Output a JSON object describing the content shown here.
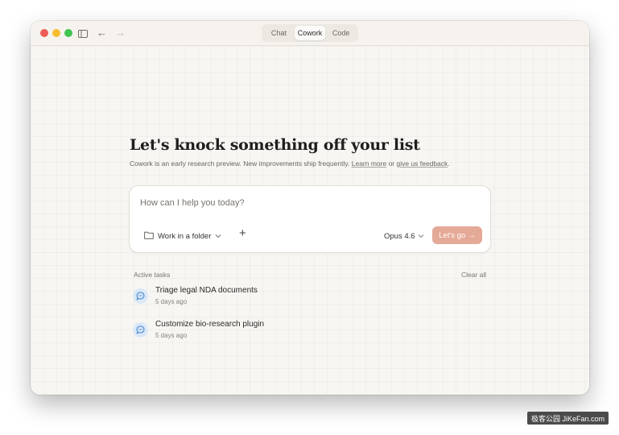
{
  "titlebar": {
    "modes": [
      "Chat",
      "Cowork",
      "Code"
    ],
    "active_mode": "Cowork"
  },
  "hero": {
    "headline": "Let's knock something off your list",
    "subtext_pre": "Cowork is an early research preview. New improvements ship frequently. ",
    "learn_more": "Learn more",
    "subtext_mid": " or ",
    "feedback": "give us feedback",
    "subtext_post": "."
  },
  "prompt": {
    "placeholder": "How can I help you today?",
    "folder_label": "Work in a folder",
    "plus": "+",
    "model": "Opus 4.6",
    "go_label": "Let's go",
    "go_arrow": "→"
  },
  "tasks": {
    "label": "Active tasks",
    "clear_label": "Clear all",
    "items": [
      {
        "title": "Triage legal NDA documents",
        "time": "5 days ago"
      },
      {
        "title": "Customize bio-research plugin",
        "time": "5 days ago"
      }
    ]
  },
  "watermark": "极客公园 JiKeFan.com",
  "colors": {
    "accent": "#e5a997",
    "window_bg": "#f8f6f3",
    "task_icon_bg": "#dbe8f7",
    "task_icon_fg": "#3d7fcb"
  },
  "icons": {
    "traffic": [
      "close-icon",
      "minimize-icon",
      "maximize-icon"
    ],
    "sidebar": "sidebar-toggle-icon",
    "back": "arrow-left-icon",
    "forward": "arrow-right-icon",
    "folder": "folder-icon",
    "chevron": "chevron-down-icon",
    "task": "chat-bubble-icon"
  }
}
